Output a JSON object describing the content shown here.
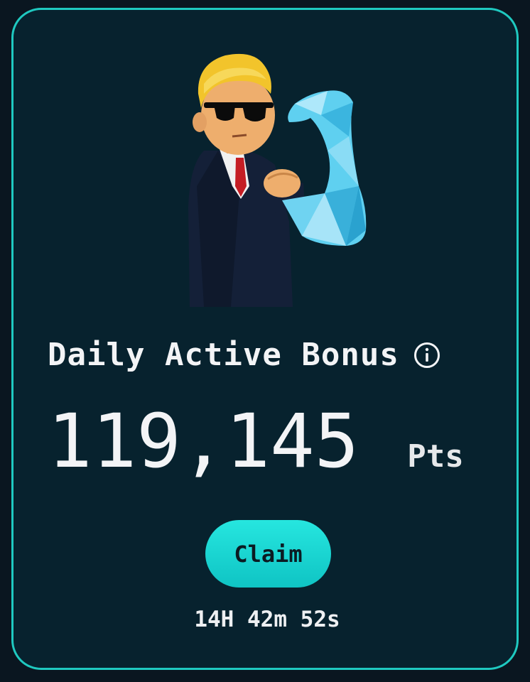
{
  "card": {
    "title": "Daily Active Bonus",
    "info_icon": "info-circle-icon",
    "mascot": "flexing-businessman-mascot",
    "points_value": "119,145",
    "points_unit": "Pts",
    "claim_label": "Claim",
    "countdown": "14H 42m 52s"
  },
  "colors": {
    "background": "#07222e",
    "border": "#1fc9c0",
    "button": "#1ad8d4",
    "text": "#f3f4f6"
  }
}
